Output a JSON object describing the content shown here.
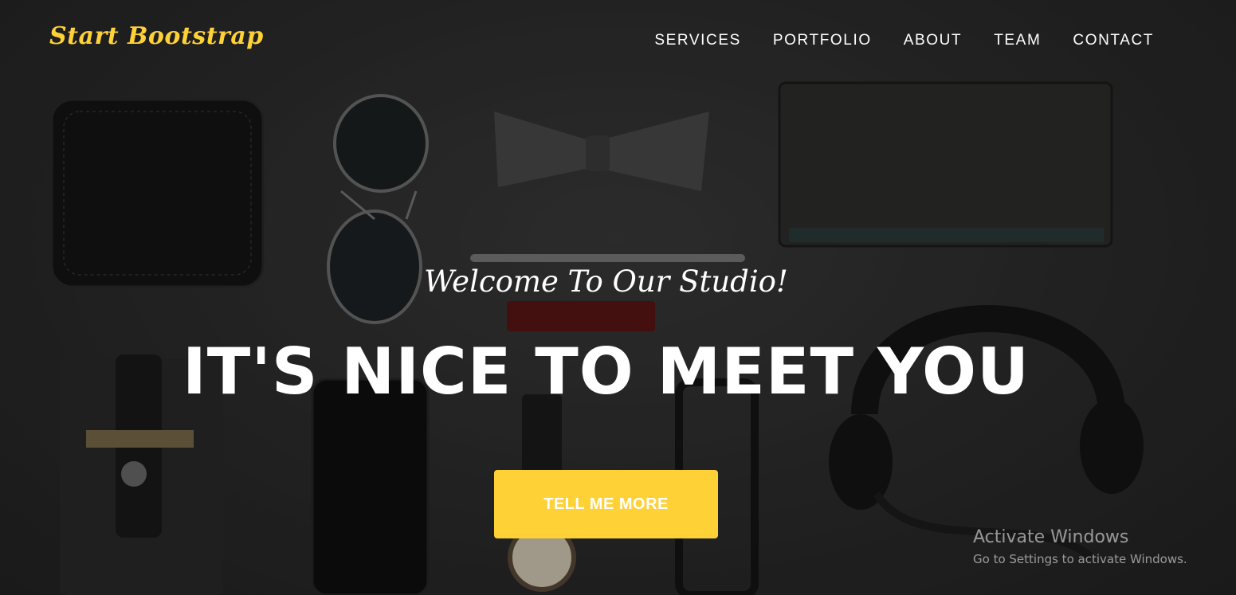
{
  "navbar": {
    "brand": "Start Bootstrap",
    "links": [
      "SERVICES",
      "PORTFOLIO",
      "ABOUT",
      "TEAM",
      "CONTACT"
    ]
  },
  "hero": {
    "subheading": "Welcome To Our Studio!",
    "heading": "IT'S NICE TO MEET YOU",
    "button_label": "TELL ME MORE"
  },
  "watermark": {
    "title": "Activate Windows",
    "subtitle": "Go to Settings to activate Windows."
  },
  "colors": {
    "accent": "#fed136",
    "text": "#ffffff",
    "background": "#2b2b2b"
  }
}
